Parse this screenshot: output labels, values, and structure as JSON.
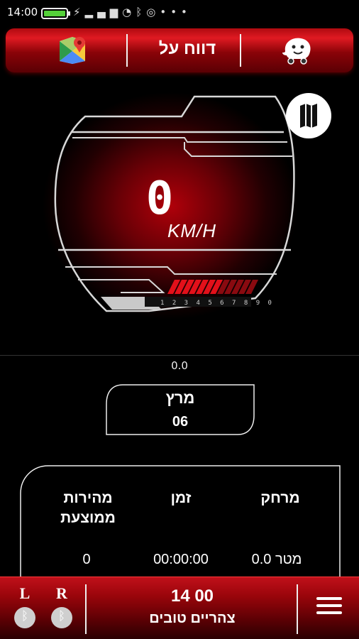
{
  "status_bar": {
    "time": "14:00",
    "icons": [
      "charging-icon",
      "signal-icon",
      "wifi-icon",
      "bluetooth-icon",
      "sync-icon",
      "more-icon"
    ]
  },
  "header": {
    "title": "דווח על",
    "left_icon": "google-maps-icon",
    "right_icon": "waze-icon"
  },
  "speedometer": {
    "speed": "0",
    "unit": "KM/H",
    "gear_ticks": "1 2 3 4 5 6 7 8 9 0",
    "rpm_bars_level": 0.45
  },
  "map_button": {
    "icon": "map-icon"
  },
  "distance_readout": "0.0",
  "month_card": {
    "name": "מרץ",
    "number": "06"
  },
  "stats": {
    "columns": [
      {
        "label": "מרחק",
        "value": "0.0 מטר"
      },
      {
        "label": "זמן",
        "value": "00:00:00"
      },
      {
        "label": "מהירות ממוצעת",
        "value": "0"
      }
    ]
  },
  "bottom_bar": {
    "left_label": "L",
    "right_label": "R",
    "clock": "14 00",
    "greeting": "צהריים טובים",
    "menu_icon": "hamburger-menu-icon"
  },
  "colors": {
    "accent_red": "#e01a22",
    "dark_red": "#5a0004",
    "battery_green": "#55d13a"
  }
}
